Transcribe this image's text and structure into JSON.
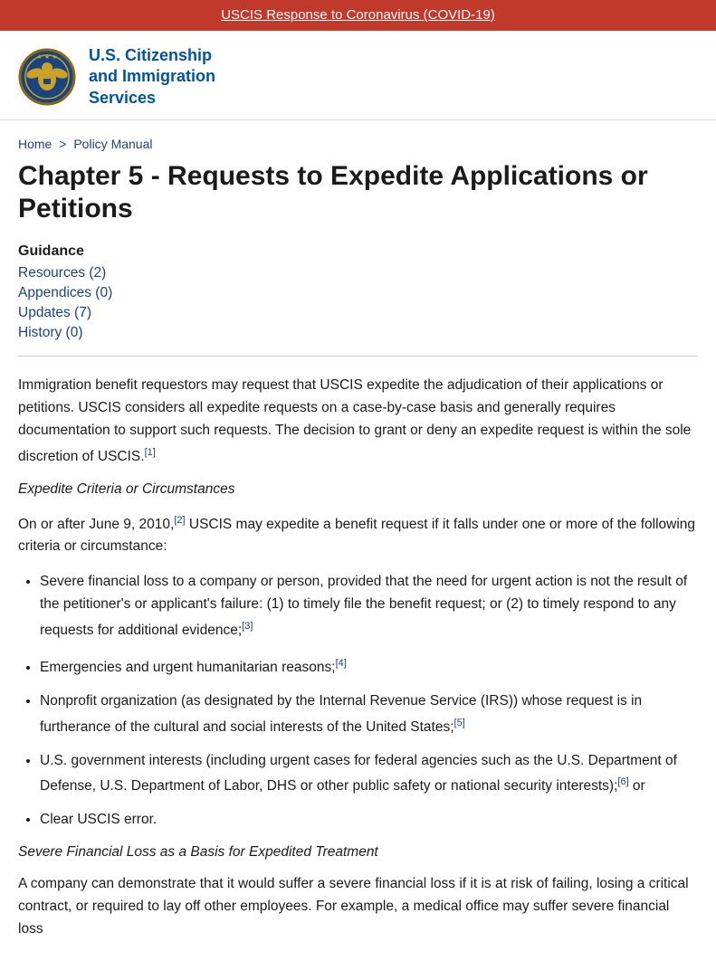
{
  "banner": {
    "text": "USCIS Response to Coronavirus (COVID-19)",
    "bg_color": "#c0392b",
    "text_color": "#ffffff"
  },
  "header": {
    "agency_name_line1": "U.S. Citizenship",
    "agency_name_line2": "and Immigration",
    "agency_name_line3": "Services"
  },
  "breadcrumb": {
    "home": "Home",
    "separator": ">",
    "current": "Policy Manual"
  },
  "page_title": "Chapter 5 - Requests to Expedite Applications or Petitions",
  "guidance": {
    "label": "Guidance",
    "links": [
      {
        "text": "Resources (2)",
        "href": "#"
      },
      {
        "text": "Appendices (0)",
        "href": "#"
      },
      {
        "text": "Updates (7)",
        "href": "#"
      },
      {
        "text": "History (0)",
        "href": "#"
      }
    ]
  },
  "body": {
    "intro_paragraph": "Immigration benefit requestors may request that USCIS expedite the adjudication of their applications or petitions. USCIS considers all expedite requests on a case-by-case basis and generally requires documentation to support such requests. The decision to grant or deny an expedite request is within the sole discretion of USCIS.",
    "intro_footnote": "[1]",
    "expedite_heading": "Expedite Criteria or Circumstances",
    "criteria_intro": "On or after June 9, 2010,",
    "criteria_footnote": "[2]",
    "criteria_text": " USCIS may expedite a benefit request if it falls under one or more of the following criteria or circumstance:",
    "bullet_items": [
      {
        "text": "Severe financial loss to a company or person, provided that the need for urgent action is not the result of the petitioner's or applicant's failure: (1) to timely file the benefit request; or (2) to timely respond to any requests for additional evidence;",
        "footnote": "[3]"
      },
      {
        "text": "Emergencies and urgent humanitarian reasons;",
        "footnote": "[4]"
      },
      {
        "text": "Nonprofit organization (as designated by the Internal Revenue Service (IRS)) whose request is in furtherance of the cultural and social interests of the United States;",
        "footnote": "[5]"
      },
      {
        "text": "U.S. government interests (including urgent cases for federal agencies such as the U.S. Department of Defense, U.S. Department of Labor, DHS or other public safety or national security interests);",
        "footnote": "[6]",
        "suffix": " or"
      },
      {
        "text": "Clear USCIS error.",
        "footnote": ""
      }
    ],
    "severe_heading": "Severe Financial Loss as a Basis for Expedited Treatment",
    "severe_paragraph": "A company can demonstrate that it would suffer a severe financial loss if it is at risk of failing, losing a critical contract, or required to lay off other employees. For example, a medical office may suffer severe financial loss"
  }
}
